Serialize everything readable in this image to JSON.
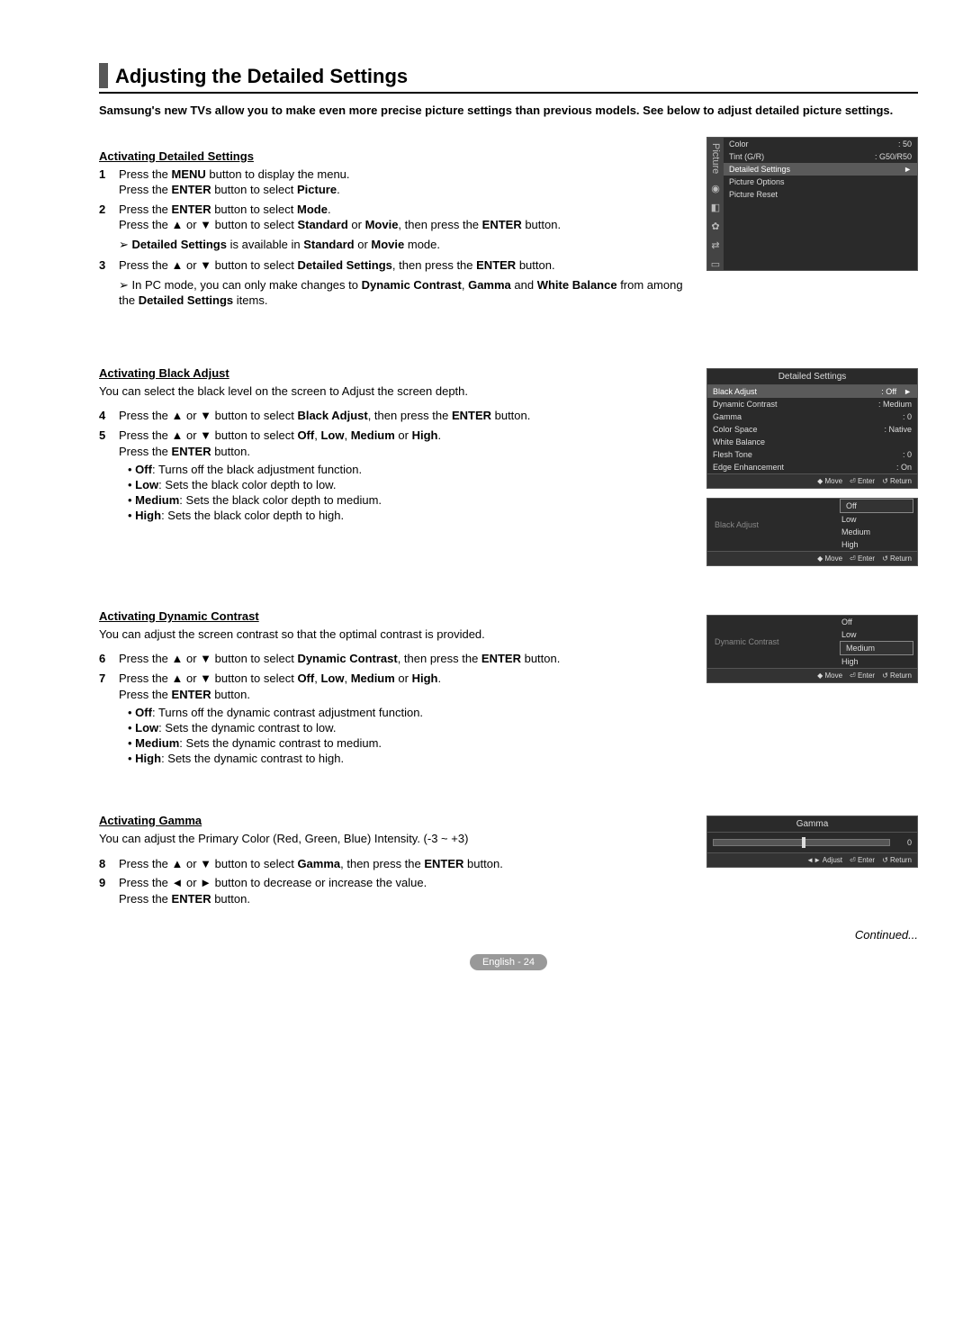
{
  "title": "Adjusting the Detailed Settings",
  "intro": "Samsung's new TVs allow you to make even more precise picture settings than previous models. See below to adjust detailed picture settings.",
  "sec1": {
    "head": "Activating Detailed Settings",
    "s1n": "1",
    "s1a": "Press the ",
    "s1b": "MENU",
    "s1c": " button to display the menu.",
    "s1d": "Press the ",
    "s1e": "ENTER",
    "s1f": " button to select ",
    "s1g": "Picture",
    "s1h": ".",
    "s2n": "2",
    "s2a": "Press the ",
    "s2b": "ENTER",
    "s2c": " button to select ",
    "s2d": "Mode",
    "s2e": ".",
    "s2f": "Press the ▲ or ▼ button to select ",
    "s2g": "Standard",
    "s2h": " or ",
    "s2i": "Movie",
    "s2j": ", then press the ",
    "s2k": "ENTER",
    "s2l": " button.",
    "n1a": "Detailed Settings",
    "n1b": " is available in ",
    "n1c": "Standard",
    "n1d": " or ",
    "n1e": "Movie",
    "n1f": " mode.",
    "s3n": "3",
    "s3a": "Press the ▲ or ▼ button to select ",
    "s3b": "Detailed Settings",
    "s3c": ", then press the ",
    "s3d": "ENTER",
    "s3e": " button.",
    "n2a": "In PC mode, you can only make changes to ",
    "n2b": "Dynamic Contrast",
    "n2c": ", ",
    "n2d": "Gamma",
    "n2e": " and ",
    "n2f": "White Balance",
    "n2g": " from among the ",
    "n2h": "Detailed Settings",
    "n2i": " items."
  },
  "sec2": {
    "head": "Activating Black Adjust",
    "intro": "You can select the black level on the screen to Adjust the screen depth.",
    "s4n": "4",
    "s4a": "Press the ▲ or ▼ button to select ",
    "s4b": "Black Adjust",
    "s4c": ", then press the ",
    "s4d": "ENTER",
    "s4e": " button.",
    "s5n": "5",
    "s5a": "Press the ▲ or ▼ button to select ",
    "s5b": "Off",
    "s5c": ", ",
    "s5d": "Low",
    "s5e": ", ",
    "s5f": "Medium",
    "s5g": " or ",
    "s5h": "High",
    "s5i": ".",
    "s5j": "Press the ",
    "s5k": "ENTER",
    "s5l": " button.",
    "b1a": "Off",
    "b1b": ": Turns off the black adjustment function.",
    "b2a": "Low",
    "b2b": ": Sets the black color depth to low.",
    "b3a": "Medium",
    "b3b": ": Sets the black color depth to medium.",
    "b4a": "High",
    "b4b": ": Sets the black color depth to high."
  },
  "sec3": {
    "head": "Activating Dynamic Contrast",
    "intro": "You can adjust the screen contrast so that the optimal contrast is provided.",
    "s6n": "6",
    "s6a": "Press the ▲ or ▼ button to select ",
    "s6b": "Dynamic Contrast",
    "s6c": ", then press the ",
    "s6d": "ENTER",
    "s6e": " button.",
    "s7n": "7",
    "s7a": "Press the ▲ or ▼ button to select ",
    "s7b": "Off",
    "s7c": ", ",
    "s7d": "Low",
    "s7e": ", ",
    "s7f": "Medium",
    "s7g": " or ",
    "s7h": "High",
    "s7i": ".",
    "s7j": "Press the ",
    "s7k": "ENTER",
    "s7l": " button.",
    "b1a": "Off",
    "b1b": ": Turns off the dynamic contrast adjustment function.",
    "b2a": "Low",
    "b2b": ": Sets the dynamic contrast to low.",
    "b3a": "Medium",
    "b3b": ": Sets the dynamic contrast to medium.",
    "b4a": "High",
    "b4b": ": Sets the dynamic contrast to high."
  },
  "sec4": {
    "head": "Activating Gamma",
    "intro": "You can adjust the Primary Color (Red, Green, Blue) Intensity. (-3 ~ +3)",
    "s8n": "8",
    "s8a": "Press the ▲ or ▼ button to select ",
    "s8b": "Gamma",
    "s8c": ", then press the ",
    "s8d": "ENTER",
    "s8e": " button.",
    "s9n": "9",
    "s9a": "Press the ◄ or ► button to decrease or increase the value.",
    "s9b": "Press the ",
    "s9c": "ENTER",
    "s9d": " button."
  },
  "continued": "Continued...",
  "pagefoot": "English - 24",
  "osd1": {
    "tab": "Picture",
    "r1": "Color",
    "r1v": ": 50",
    "r2": "Tint (G/R)",
    "r2v": ": G50/R50",
    "r3": "Detailed Settings",
    "r3v": "►",
    "r4": "Picture Options",
    "r5": "Picture Reset"
  },
  "osd2": {
    "title": "Detailed Settings",
    "r1": "Black Adjust",
    "r1v": ": Off",
    "r1a": "►",
    "r2": "Dynamic Contrast",
    "r2v": ": Medium",
    "r3": "Gamma",
    "r3v": ": 0",
    "r4": "Color Space",
    "r4v": ": Native",
    "r5": "White Balance",
    "r6": "Flesh Tone",
    "r6v": ": 0",
    "r7": "Edge Enhancement",
    "r7v": ": On",
    "f1": "◆ Move",
    "f2": "⏎ Enter",
    "f3": "↺ Return"
  },
  "osd3": {
    "label": "Black Adjust",
    "o1": "Off",
    "o2": "Low",
    "o3": "Medium",
    "o4": "High",
    "f1": "◆ Move",
    "f2": "⏎ Enter",
    "f3": "↺ Return"
  },
  "osd4": {
    "label": "Dynamic Contrast",
    "o1": "Off",
    "o2": "Low",
    "o3": "Medium",
    "o4": "High",
    "f1": "◆ Move",
    "f2": "⏎ Enter",
    "f3": "↺ Return"
  },
  "osd5": {
    "title": "Gamma",
    "val": "0",
    "f1": "◄► Adjust",
    "f2": "⏎ Enter",
    "f3": "↺ Return"
  }
}
